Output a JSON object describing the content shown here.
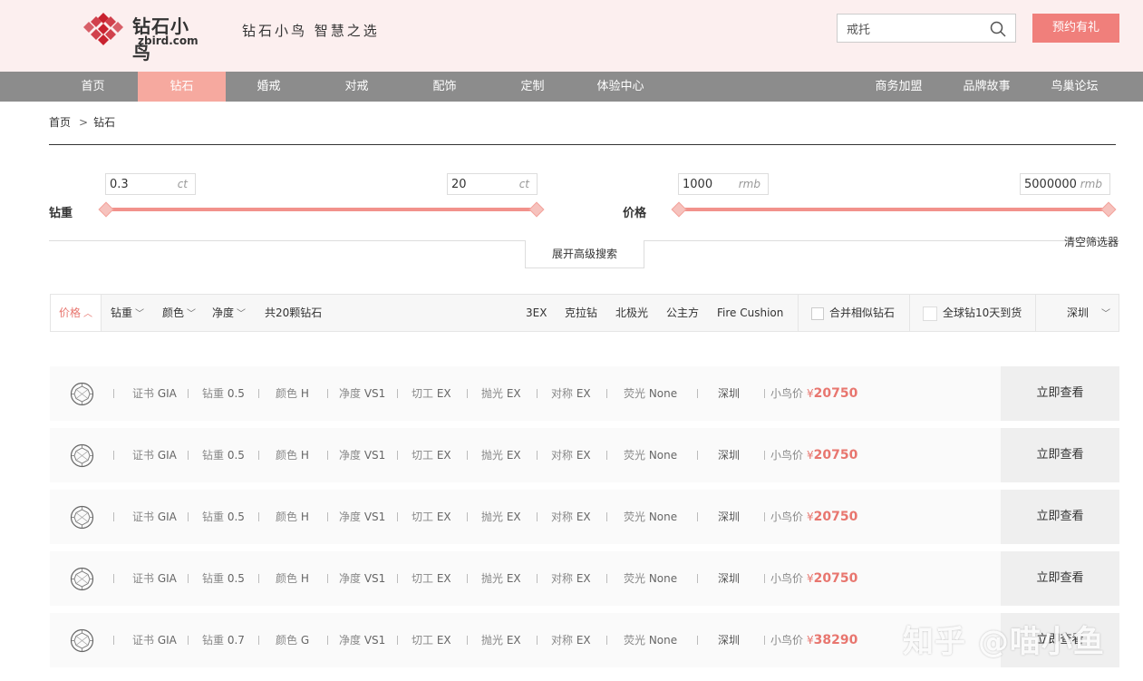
{
  "header": {
    "logo_cn": "钻石小鸟",
    "logo_en": "zbird.com",
    "slogan": "钻石小鸟 智慧之选",
    "search_value": "戒托",
    "reserve_label": "预约有礼"
  },
  "nav": {
    "items": [
      "首页",
      "钻石",
      "婚戒",
      "对戒",
      "配饰",
      "定制",
      "体验中心"
    ],
    "right_items": [
      "商务加盟",
      "品牌故事",
      "鸟巢论坛"
    ],
    "active": "钻石"
  },
  "breadcrumb": {
    "home": "首页",
    "sep": ">",
    "current": "钻石"
  },
  "filters": {
    "carat": {
      "label": "钻重",
      "min": "0.3",
      "max": "20",
      "unit": "ct"
    },
    "price": {
      "label": "价格",
      "min": "1000",
      "max": "5000000",
      "unit": "rmb"
    },
    "advanced_label": "展开高级搜索",
    "clear_label": "清空筛选器"
  },
  "sort_bar": {
    "price": "价格",
    "carat": "钻重",
    "color": "颜色",
    "clarity": "净度",
    "count_text": "共20颗钻石",
    "tags": [
      "3EX",
      "克拉钻",
      "北极光",
      "公主方",
      "Fire Cushion"
    ],
    "merge_label": "合并相似钻石",
    "global_label": "全球钻10天到货",
    "city": "深圳"
  },
  "rows": [
    {
      "cert": "GIA",
      "carat": "0.5",
      "color": "H",
      "clarity": "VS1",
      "cut": "EX",
      "polish": "EX",
      "symmetry": "EX",
      "fluor": "None",
      "city": "深圳",
      "price": "20750"
    },
    {
      "cert": "GIA",
      "carat": "0.5",
      "color": "H",
      "clarity": "VS1",
      "cut": "EX",
      "polish": "EX",
      "symmetry": "EX",
      "fluor": "None",
      "city": "深圳",
      "price": "20750"
    },
    {
      "cert": "GIA",
      "carat": "0.5",
      "color": "H",
      "clarity": "VS1",
      "cut": "EX",
      "polish": "EX",
      "symmetry": "EX",
      "fluor": "None",
      "city": "深圳",
      "price": "20750"
    },
    {
      "cert": "GIA",
      "carat": "0.5",
      "color": "H",
      "clarity": "VS1",
      "cut": "EX",
      "polish": "EX",
      "symmetry": "EX",
      "fluor": "None",
      "city": "深圳",
      "price": "20750"
    },
    {
      "cert": "GIA",
      "carat": "0.7",
      "color": "G",
      "clarity": "VS1",
      "cut": "EX",
      "polish": "EX",
      "symmetry": "EX",
      "fluor": "None",
      "city": "深圳",
      "price": "38290"
    }
  ],
  "row_labels": {
    "cert": "证书",
    "carat": "钻重",
    "color": "颜色",
    "clarity": "净度",
    "cut": "切工",
    "polish": "抛光",
    "symmetry": "对称",
    "fluor": "荧光",
    "price": "小鸟价",
    "currency": "¥",
    "view": "立即查看"
  },
  "watermark": "知乎 @喵小鱼",
  "colors": {
    "accent": "#f07f7b",
    "nav_bg": "#8c8c8c",
    "nav_active": "#f6a99f",
    "header_bg": "#fcefef",
    "price": "#e8766f"
  }
}
